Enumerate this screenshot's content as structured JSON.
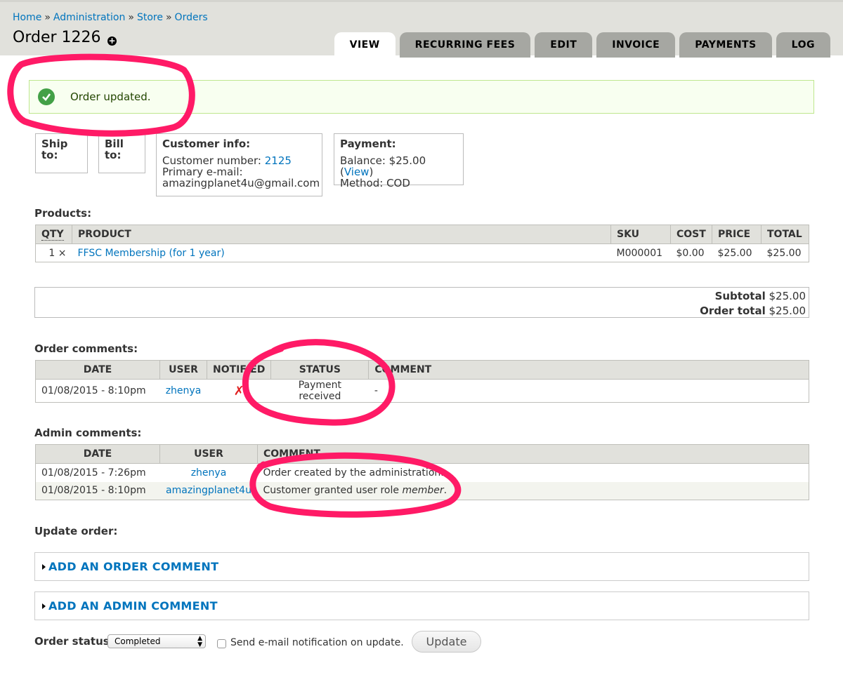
{
  "breadcrumb": {
    "items": [
      "Home",
      "Administration",
      "Store",
      "Orders"
    ],
    "separator": "»"
  },
  "page_title": "Order 1226",
  "tabs": [
    "VIEW",
    "RECURRING FEES",
    "EDIT",
    "INVOICE",
    "PAYMENTS",
    "LOG"
  ],
  "message": "Order updated.",
  "ship_to": "Ship to:",
  "bill_to": "Bill to:",
  "customer": {
    "title": "Customer info:",
    "number_label": "Customer number:",
    "number": "2125",
    "email_label": "Primary e-mail:",
    "email": "amazingplanet4u@gmail.com"
  },
  "payment": {
    "title": "Payment:",
    "balance_label": "Balance: $25.00 (",
    "view_link": "View",
    "balance_close": ")",
    "method": "Method: COD"
  },
  "products": {
    "label": "Products:",
    "headers": [
      "QTY",
      "PRODUCT",
      "SKU",
      "COST",
      "PRICE",
      "TOTAL"
    ],
    "row": {
      "qty": "1 ×",
      "product": "FFSC Membership (for 1 year)",
      "sku": "M000001",
      "cost": "$0.00",
      "price": "$25.00",
      "total": "$25.00"
    }
  },
  "totals": {
    "subtotal_label": "Subtotal",
    "subtotal": "$25.00",
    "order_total_label": "Order total",
    "order_total": "$25.00"
  },
  "order_comments": {
    "label": "Order comments:",
    "headers": [
      "DATE",
      "USER",
      "NOTIFIED",
      "STATUS",
      "COMMENT"
    ],
    "row": {
      "date": "01/08/2015 - 8:10pm",
      "user": "zhenya",
      "notified": "✗",
      "status": "Payment received",
      "comment": "-"
    }
  },
  "admin_comments": {
    "label": "Admin comments:",
    "headers": [
      "DATE",
      "USER",
      "COMMENT"
    ],
    "rows": [
      {
        "date": "01/08/2015 - 7:26pm",
        "user": "zhenya",
        "comment": "Order created by the administration."
      },
      {
        "date": "01/08/2015 - 8:10pm",
        "user": "amazingplanet4u",
        "comment_prefix": "Customer granted user role ",
        "comment_em": "member",
        "comment_suffix": "."
      }
    ]
  },
  "update_order": {
    "label": "Update order:",
    "add_order_comment": "ADD AN ORDER COMMENT",
    "add_admin_comment": "ADD AN ADMIN COMMENT",
    "status_label": "Order status",
    "status_value": "Completed",
    "notify_label": "Send e-mail notification on update.",
    "update_button": "Update"
  },
  "colors": {
    "link": "#0074bd",
    "annotation": "#ff1a66",
    "tab_bg": "#a6a7a2",
    "header_bg": "#e1e1dc"
  }
}
